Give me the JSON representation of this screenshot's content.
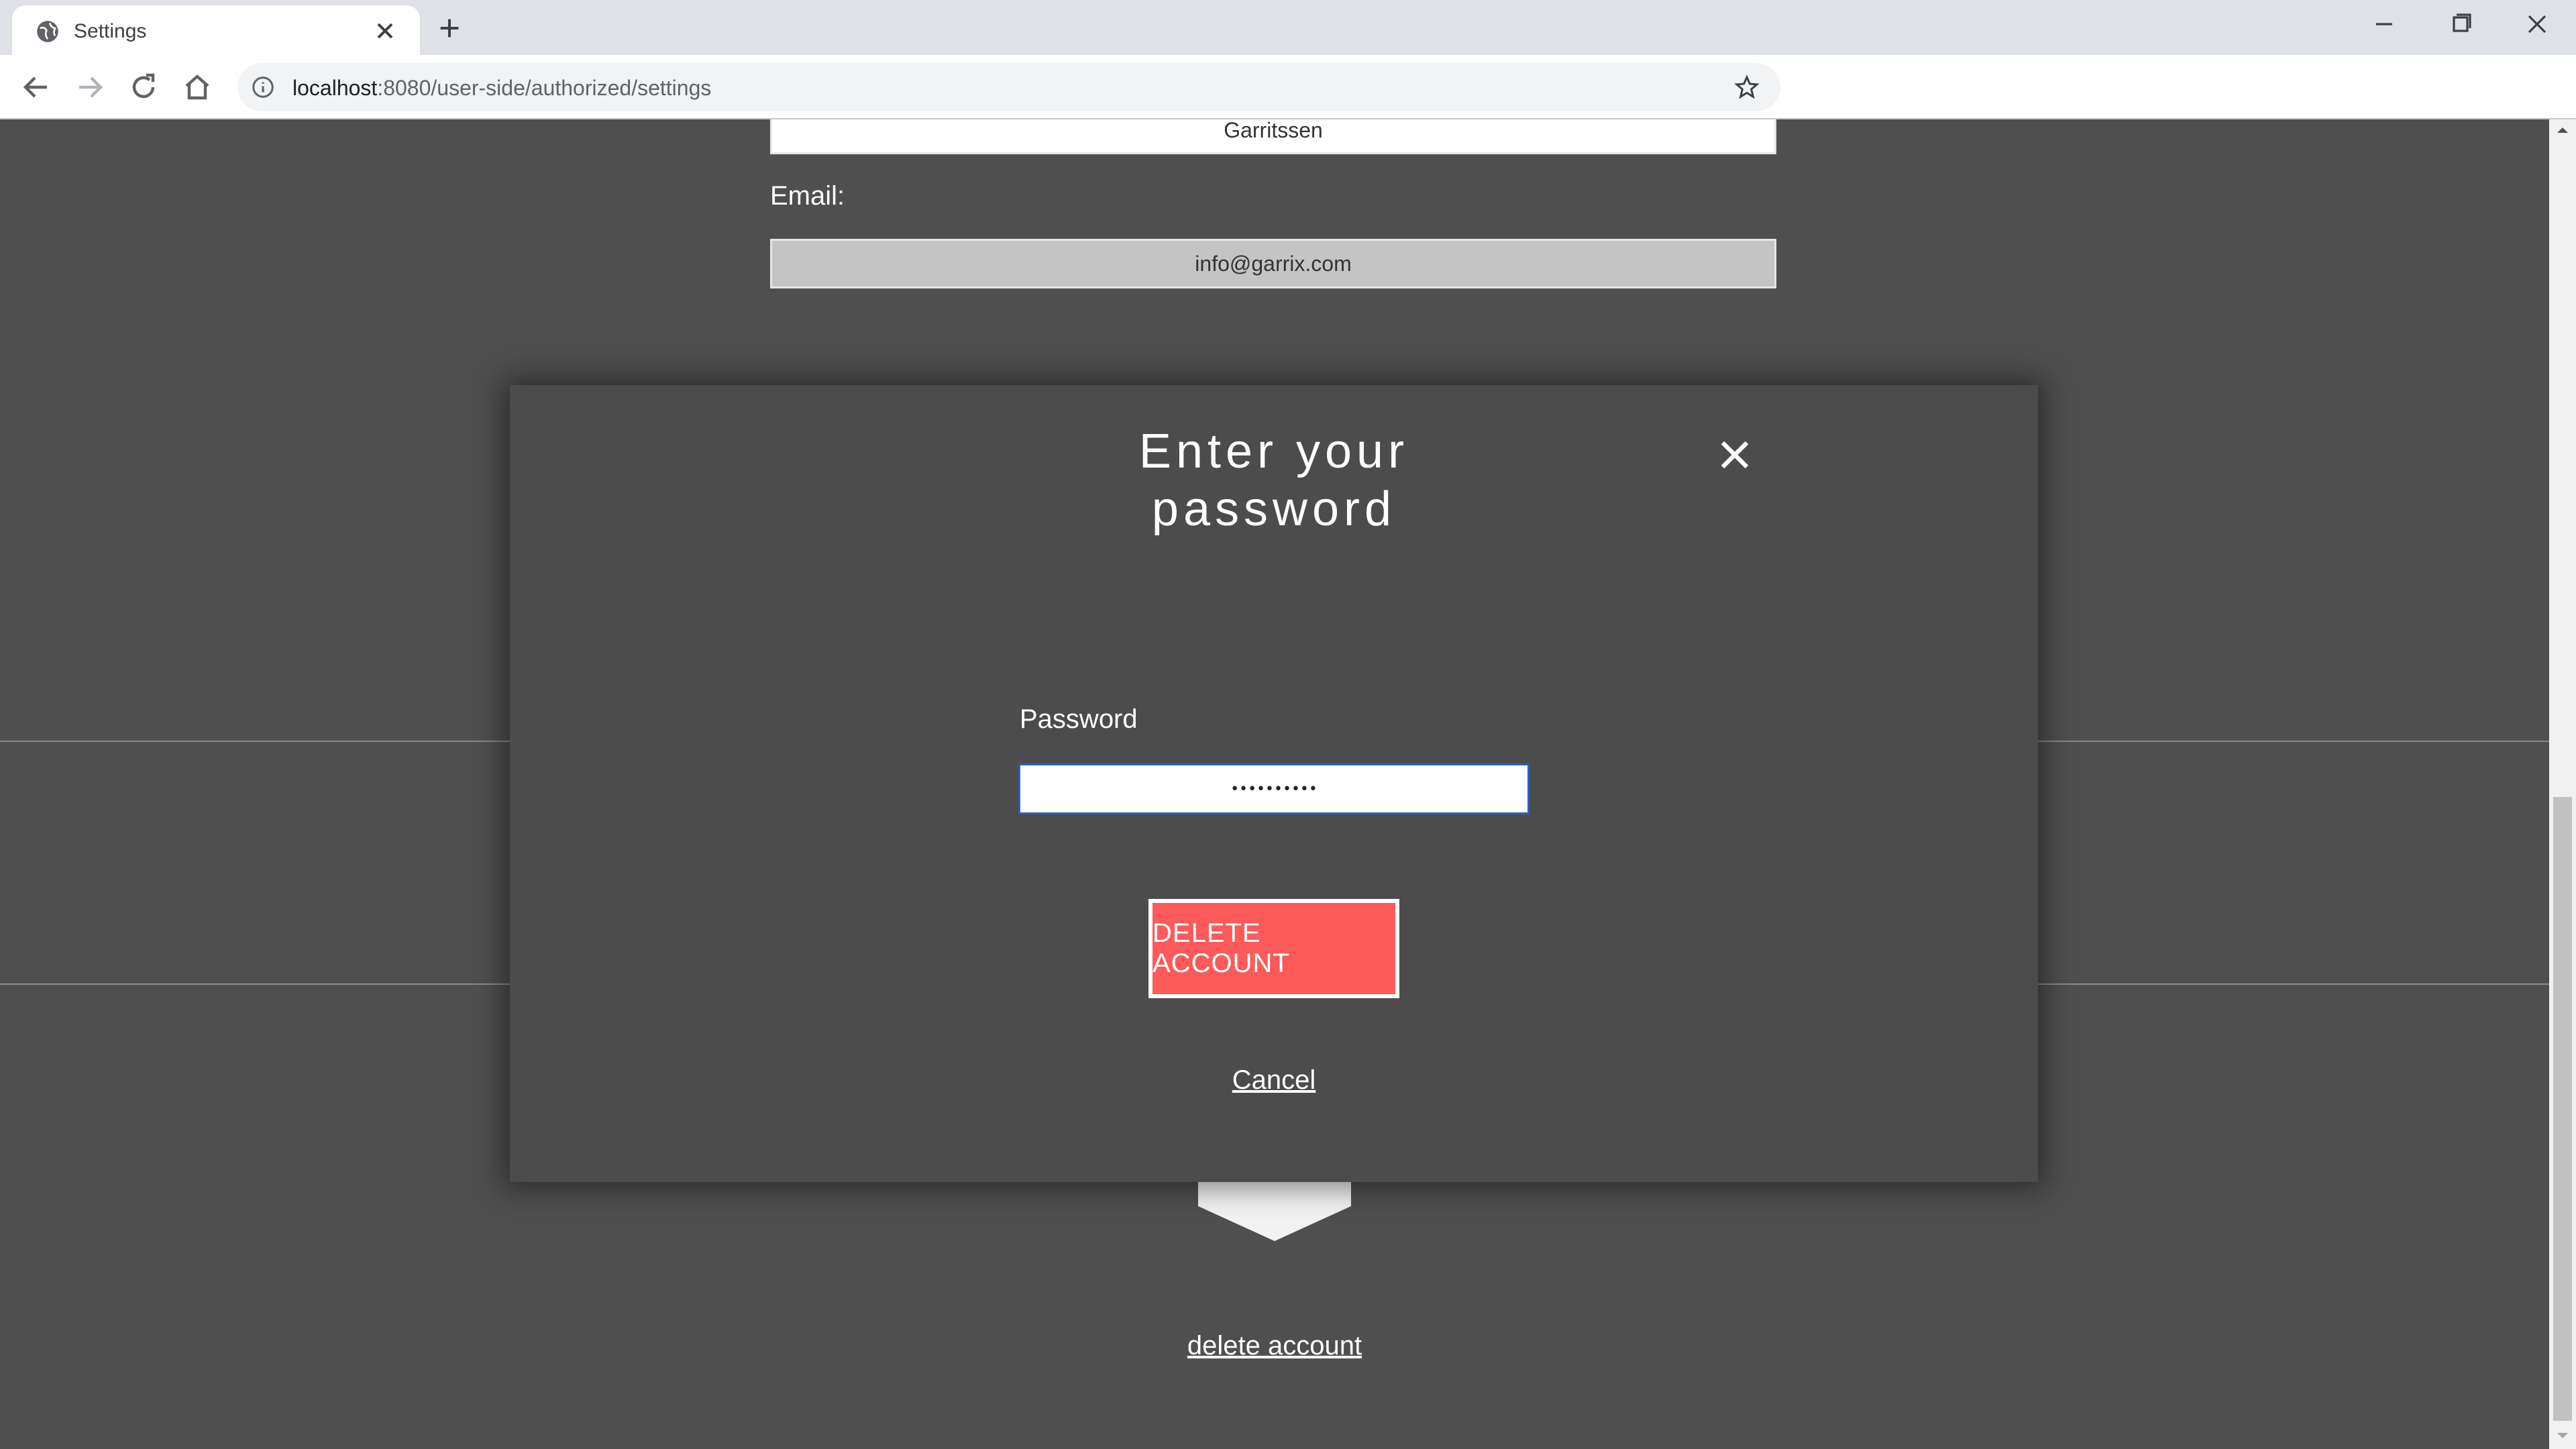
{
  "browser": {
    "tab_title": "Settings",
    "url_host": "localhost",
    "url_path": ":8080/user-side/authorized/settings"
  },
  "page": {
    "last_name_value": "Garritssen",
    "email_label": "Email:",
    "email_value": "info@garrix.com",
    "delete_link": "delete account"
  },
  "modal": {
    "title_line1": "Enter your",
    "title_line2": "password",
    "password_label": "Password",
    "password_value": "••••••••••",
    "delete_button": "DELETE ACCOUNT",
    "cancel_link": "Cancel"
  },
  "colors": {
    "page_bg": "#4f4f4f",
    "modal_bg": "#4c4c4c",
    "danger": "#fd5a5a",
    "input_focus": "#2f5fc9"
  }
}
